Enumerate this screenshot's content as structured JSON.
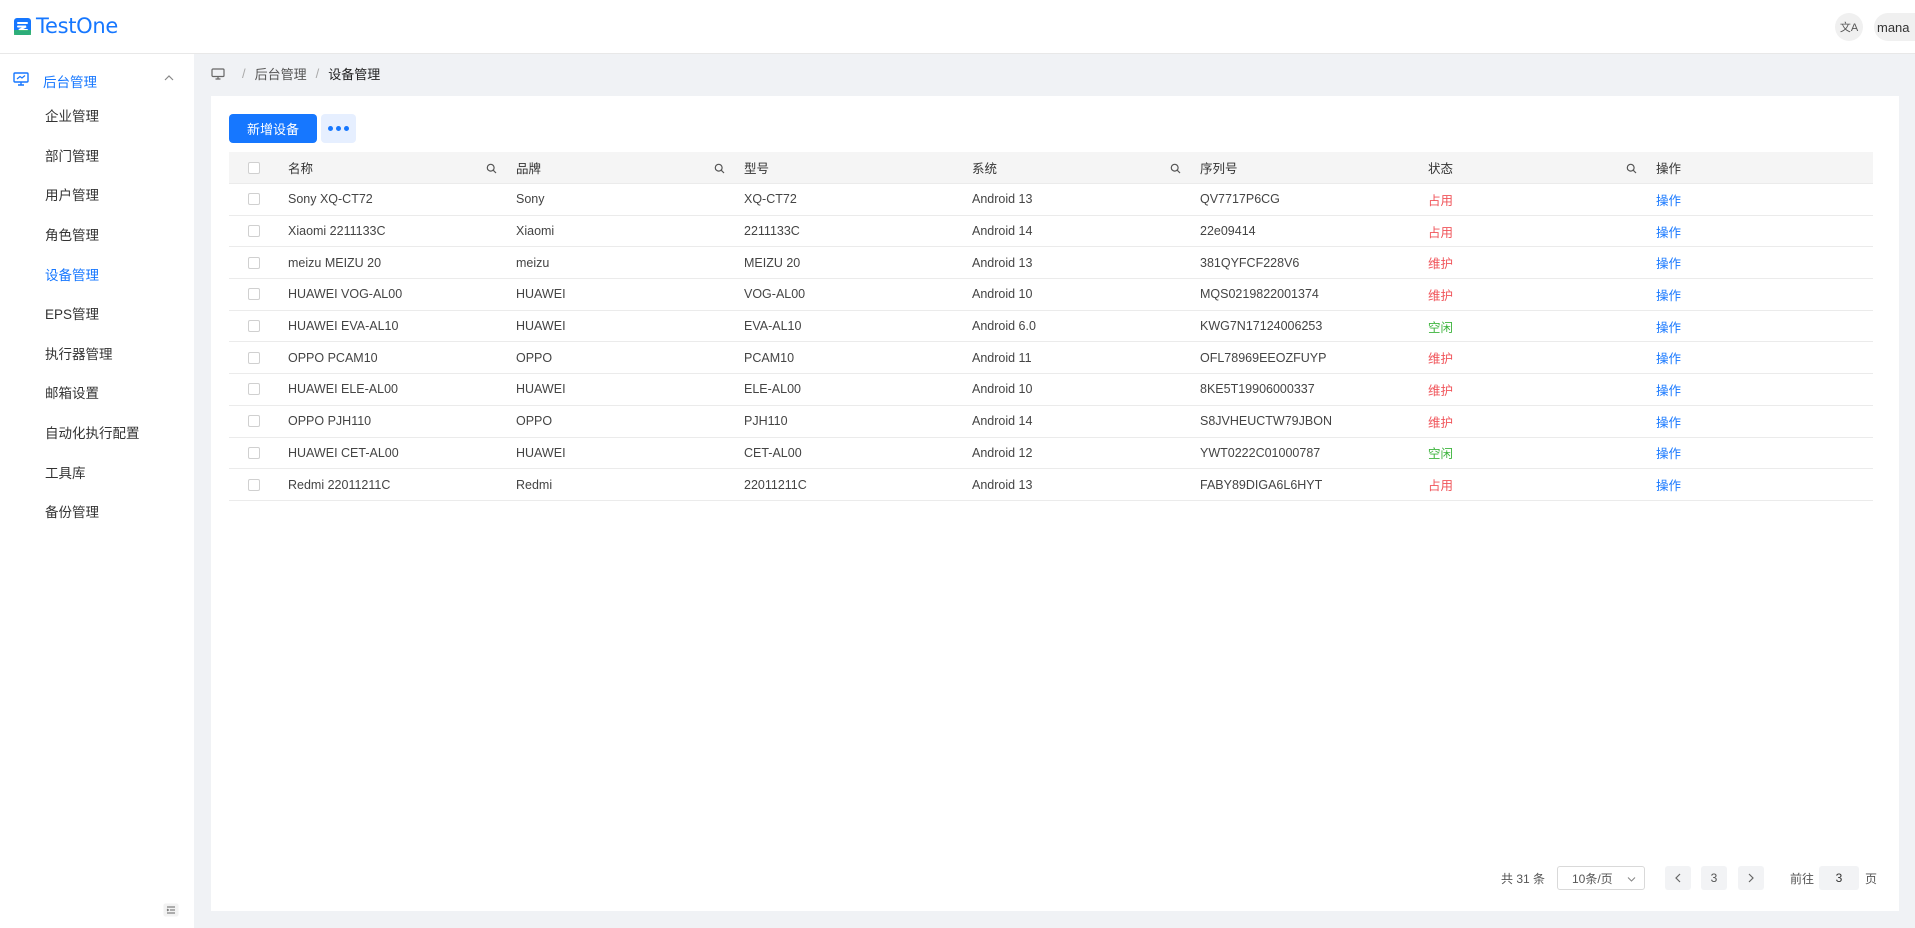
{
  "app": {
    "logo_text": "TestOne",
    "translate_label": "文A",
    "user_label": "mana"
  },
  "sidebar": {
    "group_label": "后台管理",
    "items": [
      {
        "label": "企业管理",
        "active": false
      },
      {
        "label": "部门管理",
        "active": false
      },
      {
        "label": "用户管理",
        "active": false
      },
      {
        "label": "角色管理",
        "active": false
      },
      {
        "label": "设备管理",
        "active": true
      },
      {
        "label": "EPS管理",
        "active": false
      },
      {
        "label": "执行器管理",
        "active": false
      },
      {
        "label": "邮箱设置",
        "active": false
      },
      {
        "label": "自动化执行配置",
        "active": false
      },
      {
        "label": "工具库",
        "active": false
      },
      {
        "label": "备份管理",
        "active": false
      }
    ]
  },
  "breadcrumb": {
    "sep": "/",
    "parent": "后台管理",
    "current": "设备管理"
  },
  "toolbar": {
    "add_label": "新增设备"
  },
  "table": {
    "headers": {
      "name": "名称",
      "brand": "品牌",
      "model": "型号",
      "system": "系统",
      "serial": "序列号",
      "status": "状态",
      "ops": "操作"
    },
    "rows": [
      {
        "name": "Sony XQ-CT72",
        "brand": "Sony",
        "model": "XQ-CT72",
        "system": "Android 13",
        "serial": "QV7717P6CG",
        "status": "占用",
        "status_kind": "red",
        "op": "操作"
      },
      {
        "name": "Xiaomi 2211133C",
        "brand": "Xiaomi",
        "model": "2211133C",
        "system": "Android 14",
        "serial": "22e09414",
        "status": "占用",
        "status_kind": "red",
        "op": "操作"
      },
      {
        "name": "meizu MEIZU 20",
        "brand": "meizu",
        "model": "MEIZU 20",
        "system": "Android 13",
        "serial": "381QYFCF228V6",
        "status": "维护",
        "status_kind": "red",
        "op": "操作"
      },
      {
        "name": "HUAWEI VOG-AL00",
        "brand": "HUAWEI",
        "model": "VOG-AL00",
        "system": "Android 10",
        "serial": "MQS0219822001374",
        "status": "维护",
        "status_kind": "red",
        "op": "操作"
      },
      {
        "name": "HUAWEI EVA-AL10",
        "brand": "HUAWEI",
        "model": "EVA-AL10",
        "system": "Android 6.0",
        "serial": "KWG7N17124006253",
        "status": "空闲",
        "status_kind": "green",
        "op": "操作"
      },
      {
        "name": "OPPO PCAM10",
        "brand": "OPPO",
        "model": "PCAM10",
        "system": "Android 11",
        "serial": "OFL78969EEOZFUYP",
        "status": "维护",
        "status_kind": "red",
        "op": "操作"
      },
      {
        "name": "HUAWEI ELE-AL00",
        "brand": "HUAWEI",
        "model": "ELE-AL00",
        "system": "Android 10",
        "serial": "8KE5T19906000337",
        "status": "维护",
        "status_kind": "red",
        "op": "操作"
      },
      {
        "name": "OPPO PJH110",
        "brand": "OPPO",
        "model": "PJH110",
        "system": "Android 14",
        "serial": "S8JVHEUCTW79JBON",
        "status": "维护",
        "status_kind": "red",
        "op": "操作"
      },
      {
        "name": "HUAWEI CET-AL00",
        "brand": "HUAWEI",
        "model": "CET-AL00",
        "system": "Android 12",
        "serial": "YWT0222C01000787",
        "status": "空闲",
        "status_kind": "green",
        "op": "操作"
      },
      {
        "name": "Redmi 22011211C",
        "brand": "Redmi",
        "model": "22011211C",
        "system": "Android 13",
        "serial": "FABY89DIGA6L6HYT",
        "status": "占用",
        "status_kind": "red",
        "op": "操作"
      }
    ]
  },
  "pagination": {
    "total_text": "共 31 条",
    "page_size": "10条/页",
    "current_page": "3",
    "goto_label": "前往",
    "goto_value": "3",
    "goto_unit": "页"
  },
  "colors": {
    "accent": "#1677ff",
    "status_red": "#f0545a",
    "status_green": "#3fb53f"
  }
}
